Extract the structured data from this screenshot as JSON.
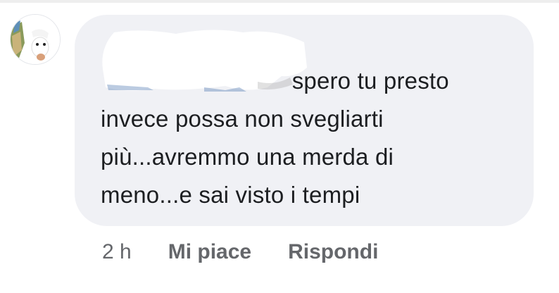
{
  "comment": {
    "text": "                             spero tu presto\ninvece possa non svegliarti\npiù...avremmo una merda di\nmeno...e sai visto i tempi",
    "timestamp": "2 h",
    "like_label": "Mi piace",
    "reply_label": "Rispondi"
  },
  "colors": {
    "bubble_background": "#f0f1f5",
    "text": "#1c1e21",
    "meta_text": "#65676b"
  },
  "icons": {
    "avatar": "profile-photo",
    "author": "redacted-name"
  }
}
